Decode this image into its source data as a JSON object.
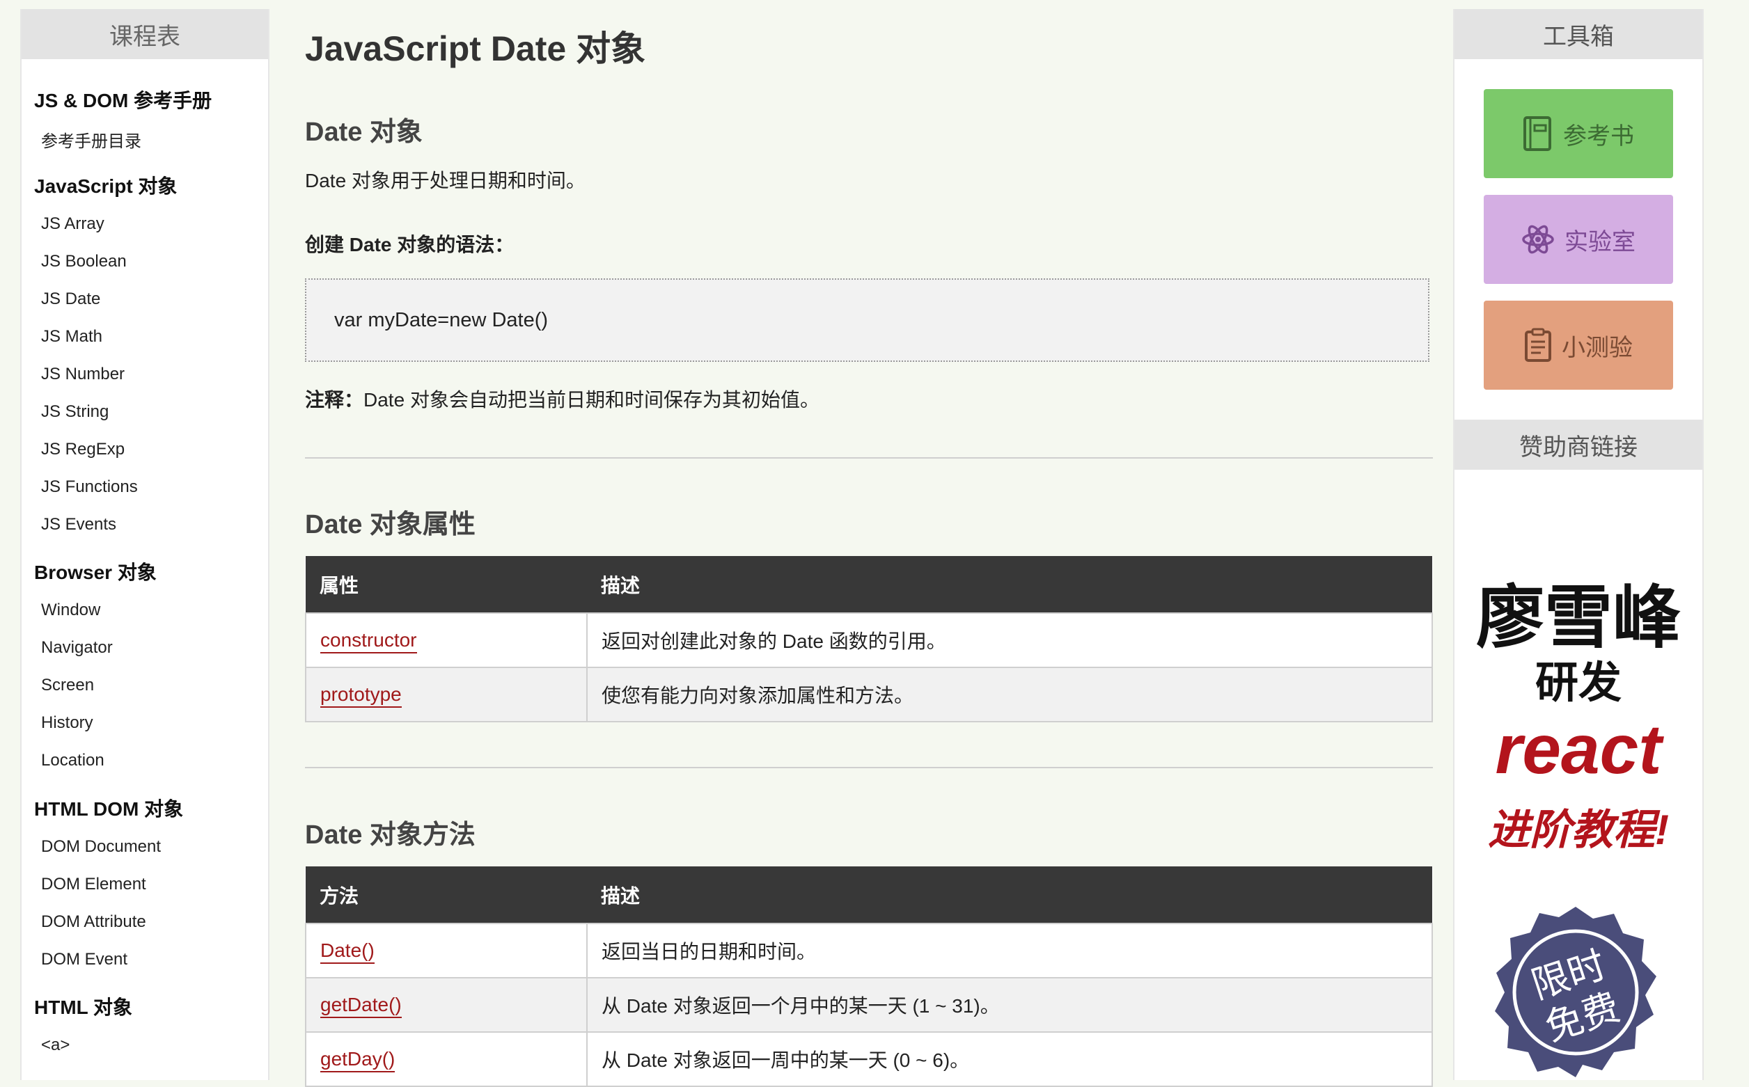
{
  "left_sidebar": {
    "header": "课程表",
    "sections": [
      {
        "title": "JS & DOM 参考手册",
        "items": [
          "参考手册目录"
        ]
      },
      {
        "title": "JavaScript 对象",
        "items": [
          "JS Array",
          "JS Boolean",
          "JS Date",
          "JS Math",
          "JS Number",
          "JS String",
          "JS RegExp",
          "JS Functions",
          "JS Events"
        ]
      },
      {
        "title": "Browser 对象",
        "items": [
          "Window",
          "Navigator",
          "Screen",
          "History",
          "Location"
        ]
      },
      {
        "title": "HTML DOM 对象",
        "items": [
          "DOM Document",
          "DOM Element",
          "DOM Attribute",
          "DOM Event"
        ]
      },
      {
        "title": "HTML 对象",
        "items": [
          "<a>"
        ]
      }
    ]
  },
  "main": {
    "title": "JavaScript Date 对象",
    "section1": {
      "heading": "Date 对象",
      "intro": "Date 对象用于处理日期和时间。",
      "syntax_label": "创建 Date 对象的语法：",
      "code": "var myDate=new Date()",
      "note_label": "注释：",
      "note_text": "Date 对象会自动把当前日期和时间保存为其初始值。"
    },
    "section2": {
      "heading": "Date 对象属性",
      "col1": "属性",
      "col2": "描述",
      "rows": [
        {
          "name": "constructor",
          "desc": "返回对创建此对象的 Date 函数的引用。"
        },
        {
          "name": "prototype",
          "desc": "使您有能力向对象添加属性和方法。"
        }
      ]
    },
    "section3": {
      "heading": "Date 对象方法",
      "col1": "方法",
      "col2": "描述",
      "rows": [
        {
          "name": "Date()",
          "desc": "返回当日的日期和时间。"
        },
        {
          "name": "getDate()",
          "desc": "从 Date 对象返回一个月中的某一天 (1 ~ 31)。"
        },
        {
          "name": "getDay()",
          "desc": "从 Date 对象返回一周中的某一天 (0 ~ 6)。"
        }
      ]
    }
  },
  "right_sidebar": {
    "header": "工具箱",
    "tools": [
      {
        "label": "参考书",
        "icon": "book-icon",
        "bg": "#7cc96a",
        "fg": "#3c6b33"
      },
      {
        "label": "实验室",
        "icon": "atom-icon",
        "bg": "#d4aee3",
        "fg": "#7d4a95"
      },
      {
        "label": "小测验",
        "icon": "clipboard-icon",
        "bg": "#e3a07e",
        "fg": "#7a4a33"
      }
    ],
    "sponsor_header": "赞助商链接",
    "ad": {
      "line1": "廖雪峰",
      "line2": "研发",
      "line3": "react",
      "line4": "进阶教程!",
      "badge": "限时免费"
    }
  }
}
